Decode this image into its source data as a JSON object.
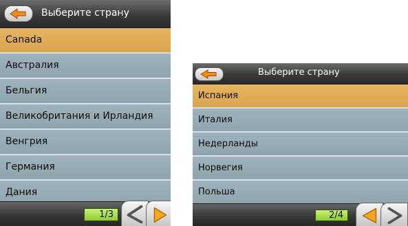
{
  "screens": [
    {
      "header": {
        "title": "Выберите страну"
      },
      "items": [
        {
          "label": "Canada"
        },
        {
          "label": "Австралия"
        },
        {
          "label": "Бельгия"
        },
        {
          "label": "Великобритания и Ирландия"
        },
        {
          "label": "Венгрия"
        },
        {
          "label": "Германия"
        },
        {
          "label": "Дания"
        }
      ],
      "selected_index": 0,
      "footer": {
        "page": "1/3"
      }
    },
    {
      "header": {
        "title": "Выберите страну"
      },
      "items": [
        {
          "label": "Испания"
        },
        {
          "label": "Италия"
        },
        {
          "label": "Недерланды"
        },
        {
          "label": "Норвегия"
        },
        {
          "label": "Польша"
        }
      ],
      "selected_index": 0,
      "footer": {
        "page": "2/4"
      }
    }
  ],
  "icons": {
    "back": "back-arrow-icon",
    "prev": "prev-arrow-icon",
    "next": "next-arrow-icon"
  },
  "colors": {
    "selected_row": "#d8a64e",
    "row": "#8fa4ad",
    "page_indicator": "#8fcd2e",
    "arrow": "#f28c1e"
  }
}
